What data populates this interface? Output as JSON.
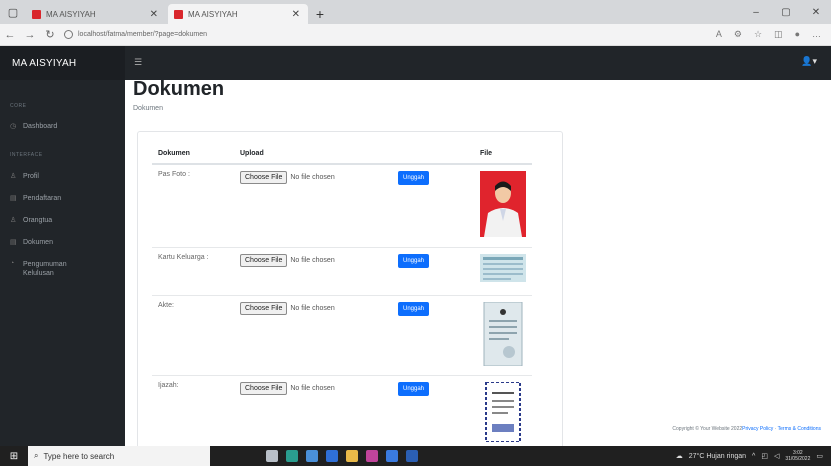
{
  "browser": {
    "tabs": [
      {
        "title": "MA AISYIYAH",
        "active": false
      },
      {
        "title": "MA AISYIYAH",
        "active": true
      }
    ],
    "url": "localhost/fatma/member/?page=dokumen",
    "new_tab_symbol": "+",
    "window_controls": [
      "–",
      "▢",
      "✕"
    ]
  },
  "app": {
    "brand": "MA AISYIYAH",
    "sidebar": {
      "section_core": "CORE",
      "dashboard": "Dashboard",
      "section_interface": "INTERFACE",
      "items": [
        {
          "label": "Profil",
          "icon": "user-icon"
        },
        {
          "label": "Pendaftaran",
          "icon": "file-icon"
        },
        {
          "label": "Orangtua",
          "icon": "user-icon"
        },
        {
          "label": "Dokumen",
          "icon": "file-icon"
        },
        {
          "label": "Pengumuman Kelulusan",
          "icon": "bell-icon"
        }
      ]
    },
    "page_title": "Dokumen",
    "breadcrumb": "Dokumen",
    "table": {
      "headers": [
        "Dokumen",
        "Upload",
        "",
        "File"
      ],
      "rows": [
        {
          "label": "Pas Foto :",
          "choose": "Choose File",
          "status": "No file chosen",
          "button": "Unggah"
        },
        {
          "label": "Kartu Keluarga :",
          "choose": "Choose File",
          "status": "No file chosen",
          "button": "Unggah"
        },
        {
          "label": "Akte:",
          "choose": "Choose File",
          "status": "No file chosen",
          "button": "Unggah"
        },
        {
          "label": "Ijazah:",
          "choose": "Choose File",
          "status": "No file chosen",
          "button": "Unggah"
        }
      ]
    },
    "footer": {
      "copyright": "Copyright © Your Website 2022",
      "privacy": "Privacy Policy",
      "sep": " · ",
      "terms": "Terms & Conditions"
    }
  },
  "taskbar": {
    "search_placeholder": "Type here to search",
    "weather": "27°C Hujan ringan",
    "time": "3:02",
    "date": "31/05/2022"
  },
  "colors": {
    "sidebar_bg": "#212529",
    "primary_button": "#0d6efd",
    "accent_red": "#d9262c"
  }
}
